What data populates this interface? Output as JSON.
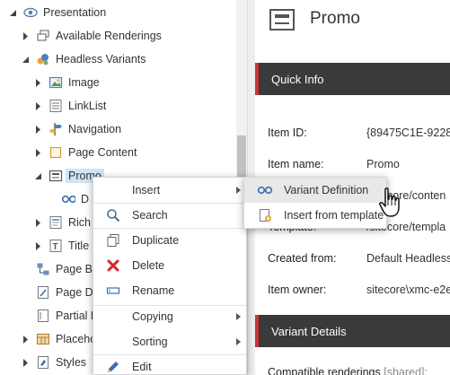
{
  "tree": {
    "items": [
      {
        "label": "Presentation",
        "icon": "eye-icon",
        "expander": "open"
      },
      {
        "label": "Available Renderings",
        "icon": "renderings-icon",
        "expander": "closed"
      },
      {
        "label": "Headless Variants",
        "icon": "variants-icon",
        "expander": "open"
      },
      {
        "label": "Image",
        "icon": "image-icon",
        "expander": "closed"
      },
      {
        "label": "LinkList",
        "icon": "list-icon",
        "expander": "closed"
      },
      {
        "label": "Navigation",
        "icon": "signpost-icon",
        "expander": "closed"
      },
      {
        "label": "Page Content",
        "icon": "page-icon",
        "expander": "closed"
      },
      {
        "label": "Promo",
        "icon": "promo-icon",
        "expander": "open",
        "selected": true
      },
      {
        "label": "D",
        "icon": "variant-definition-icon",
        "expander": "none"
      },
      {
        "label": "Rich",
        "icon": "rich-text-icon",
        "expander": "closed"
      },
      {
        "label": "Title",
        "icon": "title-icon",
        "expander": "closed"
      },
      {
        "label": "Page Br",
        "icon": "breadcrumb-icon",
        "expander": "none"
      },
      {
        "label": "Page De",
        "icon": "page-designs-icon",
        "expander": "none"
      },
      {
        "label": "Partial D",
        "icon": "partial-designs-icon",
        "expander": "none"
      },
      {
        "label": "Placeho",
        "icon": "placeholder-icon",
        "expander": "closed"
      },
      {
        "label": "Styles",
        "icon": "styles-icon",
        "expander": "closed"
      }
    ]
  },
  "context_menu": {
    "items": [
      {
        "label": "Insert",
        "icon": "",
        "submenu": true
      },
      {
        "label": "Search",
        "icon": "search-icon",
        "submenu": false
      },
      {
        "label": "Duplicate",
        "icon": "duplicate-icon",
        "submenu": false
      },
      {
        "label": "Delete",
        "icon": "delete-icon",
        "submenu": false
      },
      {
        "label": "Rename",
        "icon": "rename-icon",
        "submenu": false
      },
      {
        "label": "Copying",
        "icon": "",
        "submenu": true
      },
      {
        "label": "Sorting",
        "icon": "",
        "submenu": true
      },
      {
        "label": "Edit",
        "icon": "edit-icon",
        "submenu": false
      }
    ]
  },
  "submenu": {
    "items": [
      {
        "label": "Variant Definition",
        "icon": "variant-definition-icon",
        "highlighted": true
      },
      {
        "label": "Insert from template",
        "icon": "insert-template-icon",
        "highlighted": false
      }
    ]
  },
  "content": {
    "title": "Promo",
    "quick_info": {
      "heading": "Quick Info",
      "item_id_label": "Item ID:",
      "item_id_value": "{89475C1E-9228",
      "item_name_label": "Item name:",
      "item_name_value": "Promo",
      "item_path_value": "core/conten",
      "template_label": "Template:",
      "template_value": "/sitecore/templa",
      "created_from_label": "Created from:",
      "created_from_value": "Default Headless",
      "item_owner_label": "Item owner:",
      "item_owner_value": "sitecore\\xmc-e2e"
    },
    "variant_details": {
      "heading": "Variant Details",
      "compatible_label": "Compatible renderings",
      "compatible_shared": "[shared]:"
    }
  },
  "colors": {
    "accent_red": "#cc3333",
    "header_bar": "#3a3a3a",
    "selection": "#d0e4f5",
    "menu_highlight": "#e8e8e8",
    "delete_red": "#d9232e"
  }
}
